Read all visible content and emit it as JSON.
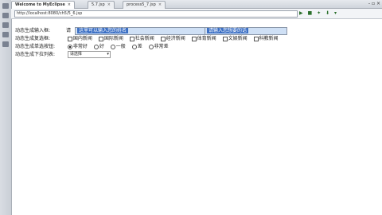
{
  "tabs": [
    {
      "label": "Welcome to MyEclipse"
    },
    {
      "label": "5.7.jsp"
    },
    {
      "label": "process5_7.jsp"
    }
  ],
  "window_controls": "- ▫ ×",
  "url": "http://localhost:8080/ch5/5_6.jsp",
  "toolbar_icons": "▶ ■ ✦ ⬇ ▾",
  "form": {
    "text_label": "动态生成输入框:",
    "text_prefix": "请",
    "text_value": "这里可以输入您的姓名",
    "text_value2": "请输入您想要的话",
    "checkbox_label": "动态生成复选框:",
    "checkboxes": [
      "国内新闻",
      "国际新闻",
      "社会新闻",
      "经济新闻",
      "体育新闻",
      "文娱新闻",
      "科教新闻"
    ],
    "radio_label": "动态生成单选按钮:",
    "radios": [
      "非常好",
      "好",
      "一般",
      "差",
      "非常差"
    ],
    "select_label": "动态生成下拉列表:",
    "select_value": "请选择"
  }
}
